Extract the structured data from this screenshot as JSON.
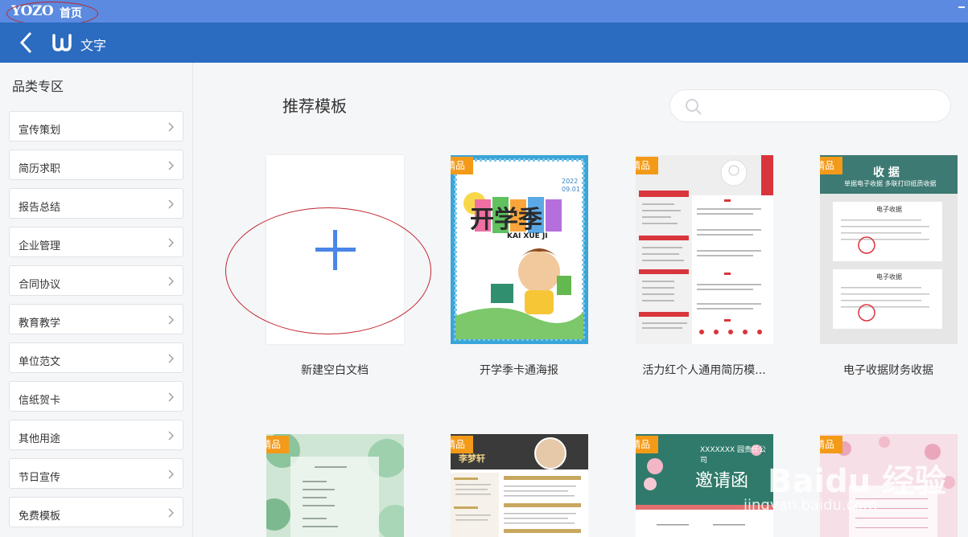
{
  "titlebar": {
    "logo": "YOZO",
    "home": "首页"
  },
  "toolbar": {
    "app_title": "文字"
  },
  "sidebar": {
    "title": "品类专区",
    "items": [
      {
        "label": "宣传策划"
      },
      {
        "label": "简历求职"
      },
      {
        "label": "报告总结"
      },
      {
        "label": "企业管理"
      },
      {
        "label": "合同协议"
      },
      {
        "label": "教育教学"
      },
      {
        "label": "单位范文"
      },
      {
        "label": "信纸贺卡"
      },
      {
        "label": "其他用途"
      },
      {
        "label": "节日宣传"
      },
      {
        "label": "免费模板"
      }
    ]
  },
  "main": {
    "section_title": "推荐模板",
    "search_placeholder": "",
    "badge": "精品",
    "cards": [
      {
        "label": "新建空白文档"
      },
      {
        "label": "开学季卡通海报"
      },
      {
        "label": "活力红个人通用简历模..."
      },
      {
        "label": "电子收据财务收据"
      }
    ],
    "thumb_text": {
      "poster_title": "开学季",
      "poster_sub": "KAI XUE JI",
      "poster_year": "2022",
      "poster_date": "09.01",
      "receipt_title": "收 据",
      "receipt_sub": "单据电子收据 多联打印纸质收据",
      "receipt_head": "电子收据",
      "resume2_name": "李梦轩",
      "invite_company": "XXXXXXX 园责任公司",
      "invite_title": "邀请函"
    }
  },
  "watermark": {
    "brand": "Baidu 经验",
    "url": "jingyan.baidu.com"
  },
  "colors": {
    "titlebar": "#5b8ae0",
    "toolbar": "#2b6bc0",
    "accent": "#4a86e8",
    "badge": "#f39a18"
  }
}
